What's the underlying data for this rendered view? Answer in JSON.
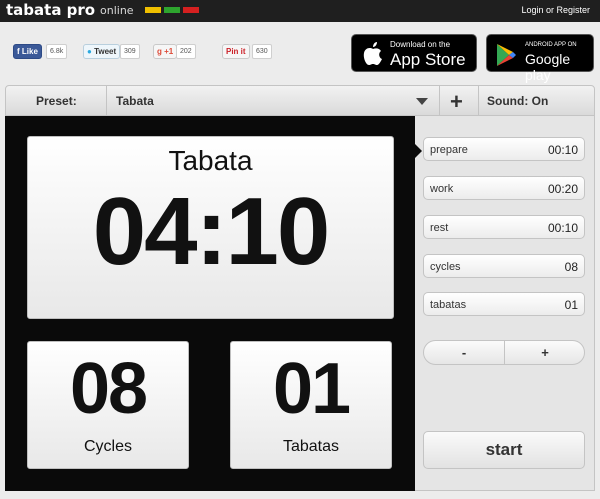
{
  "header": {
    "brand": "tabata pro",
    "brand_sub": "online",
    "swatches": [
      "#f0c000",
      "#2ea52e",
      "#d52020"
    ],
    "login": "Login or Register"
  },
  "social": {
    "facebook": {
      "label": "Like",
      "count": "6.8k"
    },
    "twitter": {
      "label": "Tweet",
      "count": "309"
    },
    "gplus": {
      "label": "+1",
      "count": "202"
    },
    "pinterest": {
      "label": "Pin it",
      "count": "630"
    }
  },
  "stores": {
    "apple": {
      "small": "Download on the",
      "big": "App Store"
    },
    "google": {
      "small": "ANDROID APP ON",
      "big": "Google play"
    }
  },
  "preset_bar": {
    "label": "Preset:",
    "value": "Tabata",
    "add": "+",
    "sound": "Sound: On"
  },
  "timer": {
    "title": "Tabata",
    "time": "04:10",
    "cycles_value": "08",
    "cycles_label": "Cycles",
    "tabatas_value": "01",
    "tabatas_label": "Tabatas"
  },
  "settings": [
    {
      "label": "prepare",
      "value": "00:10"
    },
    {
      "label": "work",
      "value": "00:20"
    },
    {
      "label": "rest",
      "value": "00:10"
    },
    {
      "label": "cycles",
      "value": "08"
    },
    {
      "label": "tabatas",
      "value": "01"
    }
  ],
  "stepper": {
    "minus": "-",
    "plus": "+"
  },
  "start_label": "start"
}
